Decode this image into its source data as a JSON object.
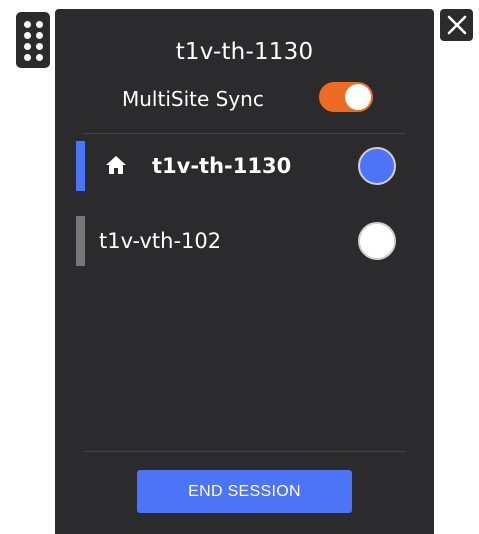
{
  "header": {
    "title": "t1v-th-1130"
  },
  "sync": {
    "label": "MultiSite Sync",
    "enabled": true,
    "accent_color": "#ee6c22"
  },
  "sites": [
    {
      "name": "t1v-th-1130",
      "is_home": true,
      "selected": true,
      "icon": "home-icon"
    },
    {
      "name": "t1v-vth-102",
      "is_home": false,
      "selected": false
    }
  ],
  "footer": {
    "end_session_label": "END SESSION"
  },
  "icons": {
    "drag": "drag-handle-icon",
    "close": "close-icon"
  },
  "colors": {
    "panel": "#2b2b2d",
    "primary": "#4d74f6",
    "inactive_bar": "#777777"
  }
}
